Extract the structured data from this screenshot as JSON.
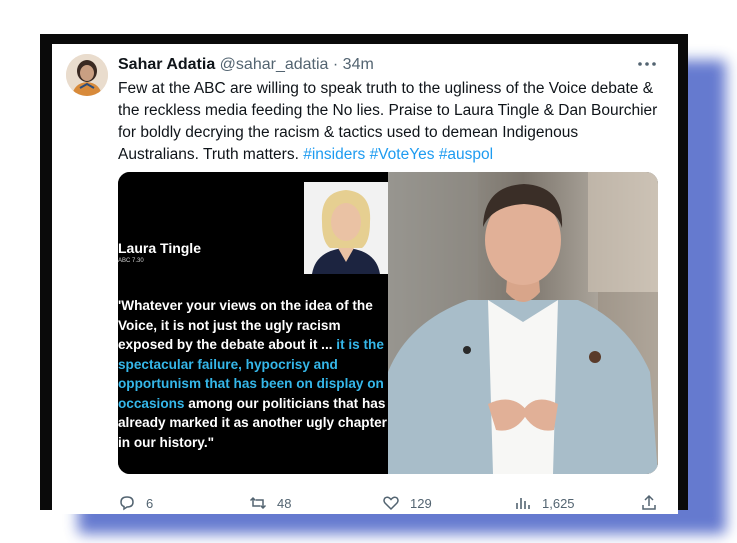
{
  "tweet": {
    "author_name": "Sahar Adatia",
    "handle": "@sahar_adatia",
    "separator": "·",
    "time": "34m",
    "more_icon": "more-horizontal-icon",
    "text_main": "Few at the ABC are willing to speak truth to the ugliness of the Voice debate & the reckless media feeding the No lies. Praise to Laura Tingle & Dan Bourchier for boldly decrying the racism & tactics used to demean Indigenous Australians. Truth matters.",
    "hashtags": [
      "#insiders",
      "#VoteYes",
      "#auspol"
    ]
  },
  "media": {
    "left_panel": {
      "name": "Laura Tingle",
      "sub": "ABC 7.30",
      "quote_part1": "'Whatever your views on the idea of the Voice, it is not just the ugly racism exposed by the debate about it ... ",
      "quote_highlight": "it is the spectacular failure, hypocrisy and opportunism that has been on display on occasions",
      "quote_part2": " among our politicians that has already marked it as another ugly chapter in our history.\""
    }
  },
  "actions": {
    "replies": "6",
    "retweets": "48",
    "likes": "129",
    "views": "1,625"
  },
  "colors": {
    "accent": "#1d9bf0",
    "quote_highlight": "#35b7e9",
    "frame": "#0a0a0a",
    "shadow": "#4b63c7"
  }
}
